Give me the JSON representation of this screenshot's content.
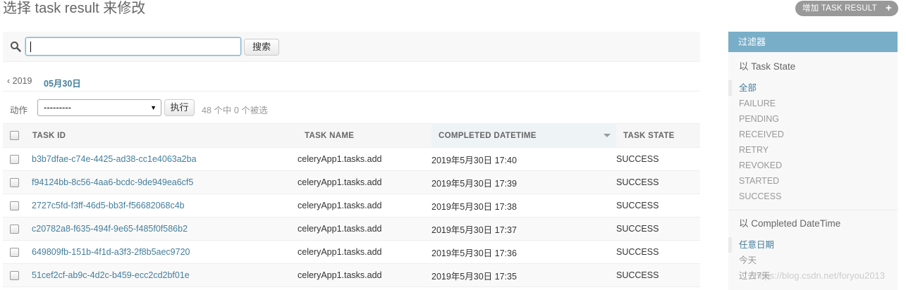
{
  "header": {
    "title": "选择 task result 来修改",
    "add_button_label": "增加 TASK RESULT",
    "add_icon": "+"
  },
  "search": {
    "button_label": "搜索",
    "value": ""
  },
  "date_hierarchy": {
    "back_label": "‹ 2019",
    "current_label": "05月30日"
  },
  "actions": {
    "label": "动作",
    "selected_option": "---------",
    "go_label": "执行",
    "counter": "48 个中 0 个被选"
  },
  "table": {
    "headers": [
      "TASK ID",
      "TASK NAME",
      "COMPLETED DATETIME",
      "TASK STATE"
    ],
    "rows": [
      {
        "task_id": "b3b7dfae-c74e-4425-ad38-cc1e4063a2ba",
        "task_name": "celeryApp1.tasks.add",
        "completed": "2019年5月30日 17:40",
        "state": "SUCCESS"
      },
      {
        "task_id": "f94124bb-8c56-4aa6-bcdc-9de949ea6cf5",
        "task_name": "celeryApp1.tasks.add",
        "completed": "2019年5月30日 17:39",
        "state": "SUCCESS"
      },
      {
        "task_id": "2727c5fd-f3ff-46d5-bb3f-f56682068c4b",
        "task_name": "celeryApp1.tasks.add",
        "completed": "2019年5月30日 17:38",
        "state": "SUCCESS"
      },
      {
        "task_id": "c20782a8-f635-494f-9e65-f485f0f586b2",
        "task_name": "celeryApp1.tasks.add",
        "completed": "2019年5月30日 17:37",
        "state": "SUCCESS"
      },
      {
        "task_id": "649809fb-151b-4f1d-a3f3-2f8b5aec9720",
        "task_name": "celeryApp1.tasks.add",
        "completed": "2019年5月30日 17:36",
        "state": "SUCCESS"
      },
      {
        "task_id": "51cef2cf-ab9c-4d2c-b459-ecc2cd2bf01e",
        "task_name": "celeryApp1.tasks.add",
        "completed": "2019年5月30日 17:35",
        "state": "SUCCESS"
      }
    ]
  },
  "filter": {
    "title": "过滤器",
    "state_heading": "以 Task State",
    "state_options": [
      "全部",
      "FAILURE",
      "PENDING",
      "RECEIVED",
      "RETRY",
      "REVOKED",
      "STARTED",
      "SUCCESS"
    ],
    "date_heading": "以 Completed DateTime",
    "date_options": [
      "任意日期",
      "今天",
      "过去7天"
    ]
  },
  "watermark": "https://blog.csdn.net/foryou2013",
  "colors": {
    "link": "#447e9b",
    "filter_header": "#79aec8",
    "add_button": "#999999"
  }
}
